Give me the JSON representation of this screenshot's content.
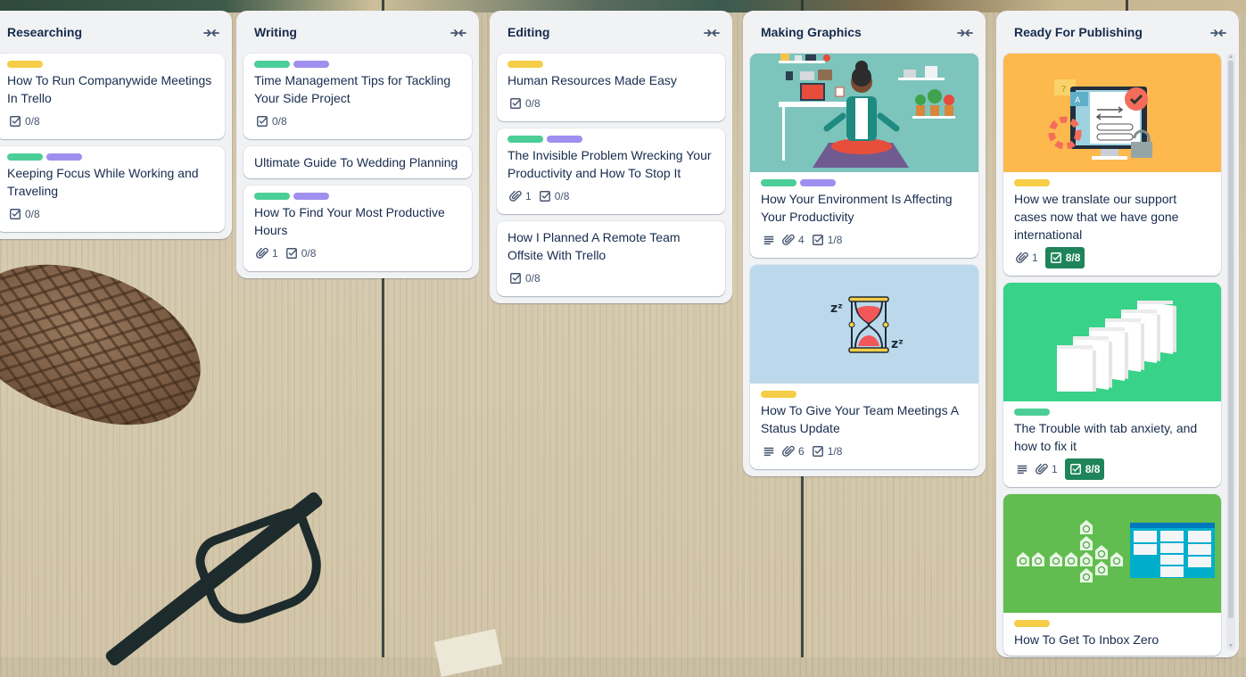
{
  "colors": {
    "green_label": "#4bce97",
    "purple_label": "#9f8fef",
    "yellow_label": "#f5cd47",
    "done_badge": "#1f845a",
    "list_bg": "#f1f2f4",
    "text": "#172b4d"
  },
  "lists": [
    {
      "title": "Researching",
      "collapse_icon": "collapse-icon",
      "cards": [
        {
          "labels": [
            "yellow"
          ],
          "title": "How To Run Companywide Meetings In Trello",
          "checklist": "0/8"
        },
        {
          "labels": [
            "green",
            "purple"
          ],
          "title": "Keeping Focus While Working and Traveling",
          "checklist": "0/8"
        }
      ]
    },
    {
      "title": "Writing",
      "collapse_icon": "collapse-icon",
      "cards": [
        {
          "labels": [
            "green",
            "purple"
          ],
          "title": "Time Management Tips for Tackling Your Side Project",
          "checklist": "0/8"
        },
        {
          "labels": [],
          "title": "Ultimate Guide To Wedding Planning"
        },
        {
          "labels": [
            "green",
            "purple"
          ],
          "title": "How To Find Your Most Productive Hours",
          "attachments": "1",
          "checklist": "0/8"
        }
      ]
    },
    {
      "title": "Editing",
      "collapse_icon": "collapse-icon",
      "cards": [
        {
          "labels": [
            "yellow"
          ],
          "title": "Human Resources Made Easy",
          "checklist": "0/8"
        },
        {
          "labels": [
            "green",
            "purple"
          ],
          "title": "The Invisible Problem Wrecking Your Productivity and How To Stop It",
          "attachments": "1",
          "checklist": "0/8"
        },
        {
          "labels": [],
          "title": "How I Planned A Remote Team Offsite With Trello",
          "checklist": "0/8"
        }
      ]
    },
    {
      "title": "Making Graphics",
      "collapse_icon": "collapse-icon",
      "cards": [
        {
          "cover": "meditation-illustration",
          "cover_color": "#7cc4bc",
          "labels": [
            "green",
            "purple"
          ],
          "title": "How Your Environment Is Affecting Your Productivity",
          "description": true,
          "attachments": "4",
          "checklist": "1/8"
        },
        {
          "cover": "hourglass-illustration",
          "cover_color": "#bcd9ec",
          "labels": [
            "yellow"
          ],
          "title": "How To Give Your Team Meetings A Status Update",
          "description": true,
          "attachments": "6",
          "checklist": "1/8"
        }
      ]
    },
    {
      "title": "Ready For Publishing",
      "collapse_icon": "collapse-icon",
      "cards": [
        {
          "cover": "support-translation-illustration",
          "cover_color": "#fdb84e",
          "labels": [
            "yellow"
          ],
          "title": "How we translate our support cases now that we have gone international",
          "attachments": "1",
          "checklist": "8/8",
          "checklist_complete": true
        },
        {
          "cover": "browser-tabs-illustration",
          "cover_color": "#38d288",
          "labels": [
            "green"
          ],
          "title": "The Trouble with tab anxiety, and how to fix it",
          "description": true,
          "attachments": "1",
          "checklist": "8/8",
          "checklist_complete": true
        },
        {
          "cover": "inbox-zero-illustration",
          "cover_color": "#61bd4f",
          "labels": [
            "yellow"
          ],
          "title": "How To Get To Inbox Zero"
        }
      ]
    }
  ]
}
